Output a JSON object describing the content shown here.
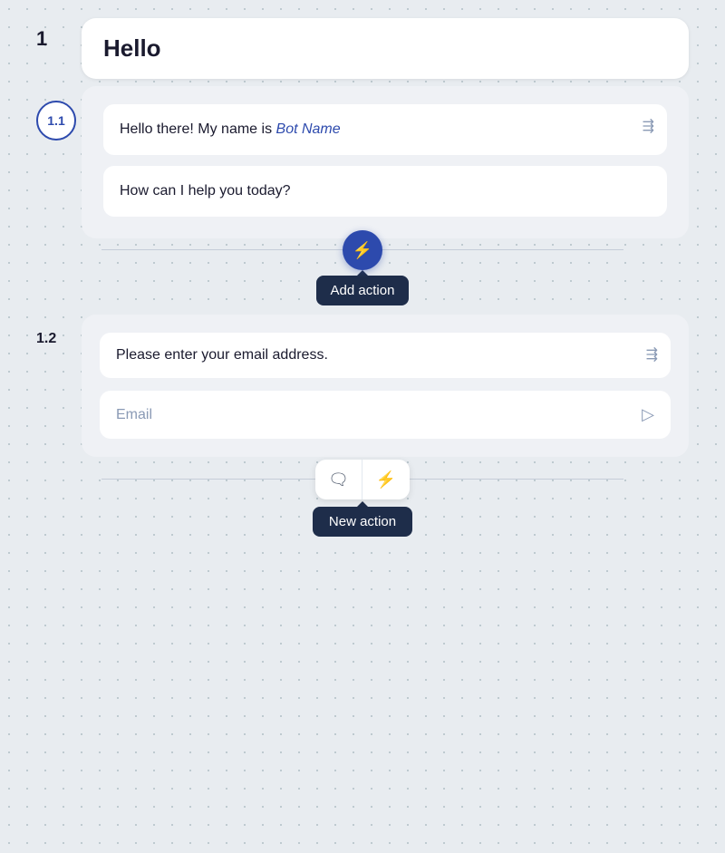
{
  "step1": {
    "number": "1",
    "title": "Hello"
  },
  "step1_1": {
    "number": "1.1",
    "message1_prefix": "Hello there! My name is ",
    "bot_name": "Bot Name",
    "message2": "How can I help you today?"
  },
  "connector": {
    "tooltip": "Add action"
  },
  "step1_2": {
    "number": "1.2",
    "message": "Please enter your email address.",
    "input_placeholder": "Email"
  },
  "bottom": {
    "new_action_label": "New action",
    "message_icon": "💬",
    "lightning_icon": "⚡"
  }
}
